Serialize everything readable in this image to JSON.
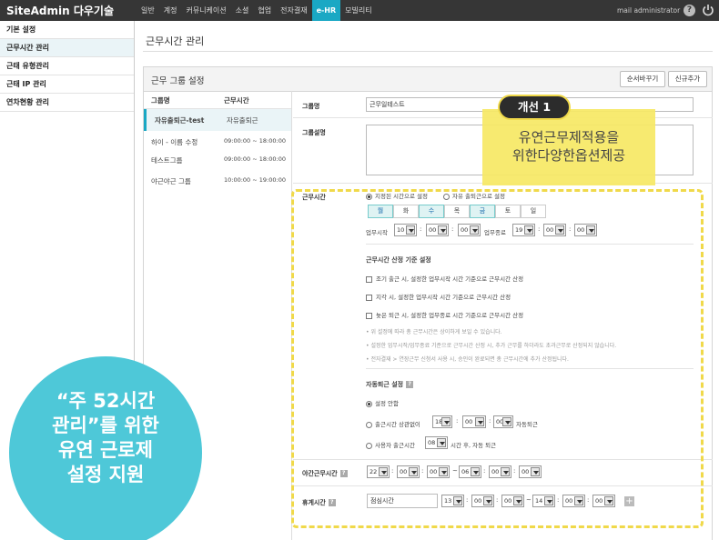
{
  "topbar": {
    "brand": "SiteAdmin 다우기술",
    "nav": [
      "일반",
      "계정",
      "커뮤니케이션",
      "소셜",
      "협업",
      "전자결재",
      "e-HR",
      "모빌리티"
    ],
    "active_nav": "e-HR",
    "user": "mail administrator"
  },
  "sidebar": {
    "items": [
      "기본 설정",
      "근무시간 관리",
      "근태 유형관리",
      "근태 IP 관리",
      "연차현황 관리"
    ],
    "active": "근무시간 관리"
  },
  "page": {
    "title": "근무시간 관리",
    "panel_title": "근무 그룹 설정",
    "buttons": {
      "reorder": "순서바꾸기",
      "add": "신규추가"
    }
  },
  "groups": {
    "headers": {
      "name": "그룹명",
      "time": "근무시간"
    },
    "rows": [
      {
        "name": "자유출퇴근-test",
        "time": "자유출퇴근"
      },
      {
        "name": "하이 - 이름 수정",
        "time": "09:00:00 ~ 18:00:00"
      },
      {
        "name": "테스트그룹",
        "time": "09:00:00 ~ 18:00:00"
      },
      {
        "name": "야근야근 그룹",
        "time": "10:00:00 ~ 19:00:00"
      }
    ]
  },
  "form": {
    "group_name_label": "그룹명",
    "group_name_value": "근무일테스트",
    "group_desc_label": "그룹설명",
    "work_time_label": "근무시간",
    "work_time_opt1": "지정된 시간으로 설정",
    "work_time_opt2": "자유 출퇴근으로 설정",
    "days": [
      "월",
      "화",
      "수",
      "목",
      "금",
      "토",
      "일"
    ],
    "days_selected": [
      "월",
      "화",
      "수",
      "금"
    ],
    "start_label": "업무시작",
    "start": {
      "h": "10",
      "m": "00",
      "s": "00"
    },
    "end_label": "업무종료",
    "end": {
      "h": "19",
      "m": "00",
      "s": "00"
    },
    "calc_title": "근무시간 산정 기준 설정",
    "calc_opts": [
      "조기 출근 시, 설정한 업무시작 시간 기준으로 근무시간 산정",
      "지각 시, 설정한 업무시작 시간 기준으로 근무시간 산정",
      "늦은 퇴근 시, 설정한 업무종료 시간 기준으로 근무시간 산정"
    ],
    "notes": [
      "• 위 설정에 따라 총 근무시간은 상이하게 보일 수 있습니다.",
      "• 설정한 업무시작/업무종료 기준으로 근무시간 산정 시, 추가 근무를 하더라도 초과근무로 산정되지 않습니다.",
      "• 전자결재 > 연장근무 신청서 사용 시, 승인이 완료되면 총 근무시간에 추가 산정됩니다."
    ],
    "auto_title": "자동퇴근 설정",
    "auto_opt1": "설정 안함",
    "auto_opt2_pre": "출근시간 상관없이",
    "auto_opt2_time": {
      "h": "18",
      "m": "00",
      "s": "00"
    },
    "auto_opt2_post": "자동퇴근",
    "auto_opt3_pre": "사용자 출근시간",
    "auto_opt3_hours": "08",
    "auto_opt3_post": "시간 후, 자동 퇴근",
    "night_label": "야간근무시간",
    "night_start": {
      "h": "22",
      "m": "00",
      "s": "00"
    },
    "night_end": {
      "h": "06",
      "m": "00",
      "s": "00"
    },
    "break_label": "휴게시간",
    "break_name": "점심시간",
    "break_start": {
      "h": "13",
      "m": "00",
      "s": "00"
    },
    "break_end": {
      "h": "14",
      "m": "00",
      "s": "00"
    },
    "time_sep": ":",
    "range_sep": "~"
  },
  "callout": {
    "tab": "개선 1",
    "line1": "유연근무제적용을",
    "line2": "위한다양한옵션제공"
  },
  "badge": {
    "line1": "“주 52시간",
    "line2": "관리”를 위한",
    "line3": "유연 근로제",
    "line4": "설정 지원"
  },
  "colors": {
    "accent": "#1aa8c4",
    "highlight": "#f0d94a",
    "badge": "#4ec8d8"
  }
}
